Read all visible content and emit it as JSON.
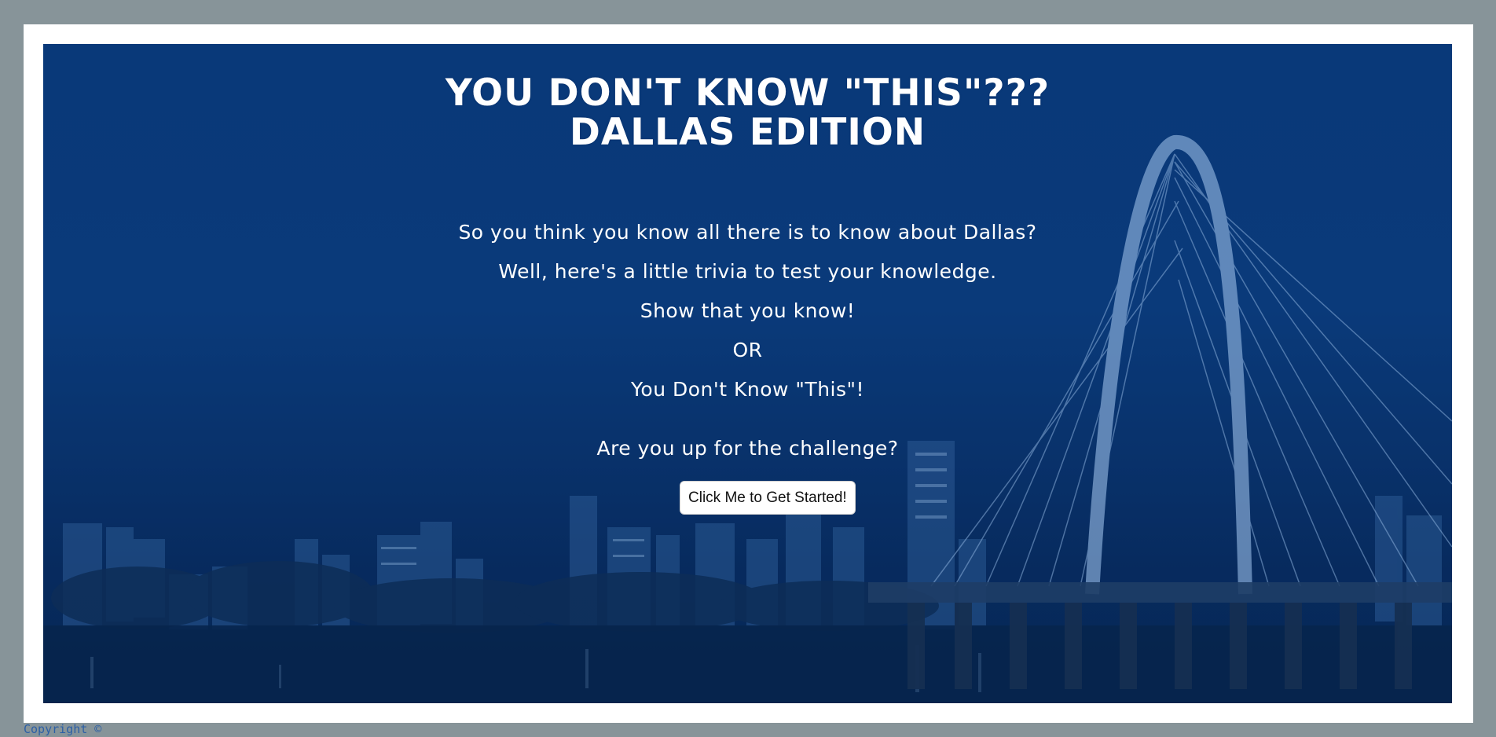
{
  "hero": {
    "title_line1": "You Don't Know \"This\"???",
    "title_line2": "Dallas Edition",
    "lines": [
      "So you think you know all there is to know about Dallas?",
      "Well, here's a little trivia to test your knowledge.",
      "Show that you know!",
      "OR",
      "You Don't Know \"This\"!",
      "Are you up for the challenge?"
    ],
    "start_button_label": "Click Me to Get Started!"
  },
  "footer": {
    "copyright": "Copyright ©"
  },
  "colors": {
    "page_background": "#879499",
    "frame": "#ffffff",
    "hero_overlay": "#093878",
    "text": "#ffffff",
    "copyright_text": "#2b5fa6"
  }
}
